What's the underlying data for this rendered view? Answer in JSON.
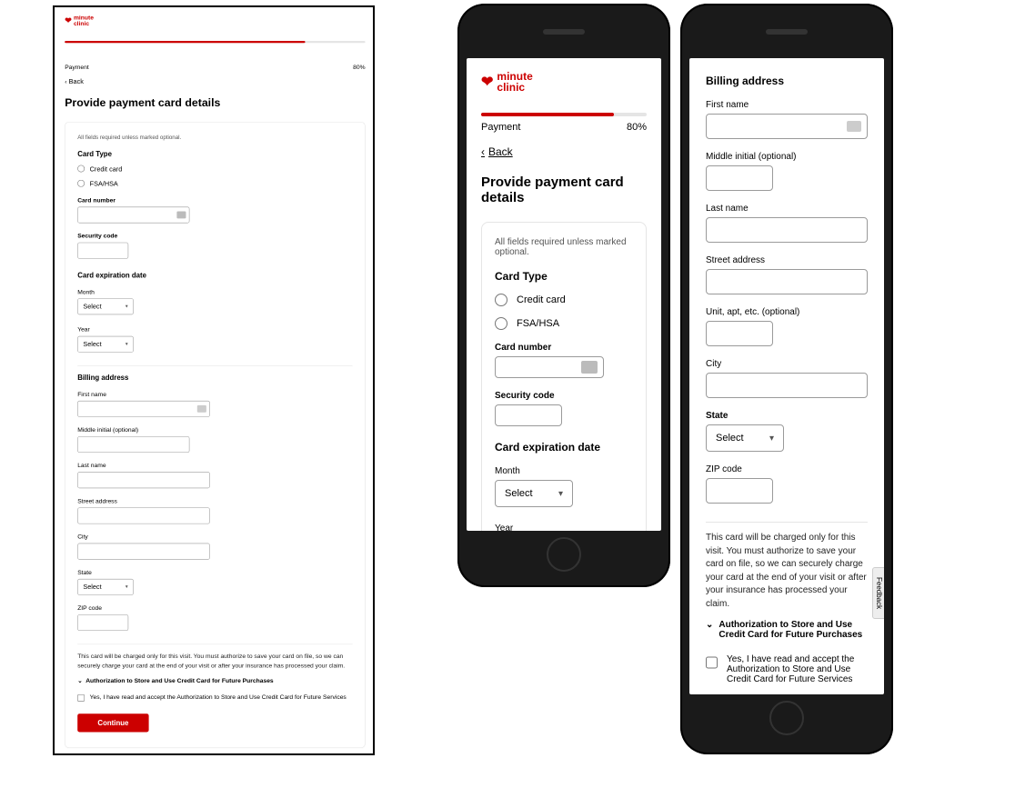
{
  "brand": {
    "name_line1": "minute",
    "name_line2": "clinic"
  },
  "progress": {
    "step_label": "Payment",
    "percent_label": "80%",
    "percent_value": 80
  },
  "back_label": "Back",
  "page_title": "Provide payment card details",
  "form": {
    "required_hint": "All fields required unless marked optional.",
    "card_type": {
      "label": "Card Type",
      "option_credit": "Credit card",
      "option_fsa": "FSA/HSA"
    },
    "card_number_label": "Card number",
    "security_code_label": "Security code",
    "expiration_label": "Card expiration date",
    "month_label": "Month",
    "year_label": "Year",
    "select_placeholder": "Select"
  },
  "billing": {
    "section_label": "Billing address",
    "first_name": "First name",
    "middle_initial": "Middle initial (optional)",
    "last_name": "Last name",
    "street": "Street address",
    "unit": "Unit, apt, etc. (optional)",
    "city": "City",
    "state": "State",
    "zip": "ZIP code"
  },
  "disclosure": {
    "text": "This card will be charged only for this visit. You must authorize to save your card on file, so we can securely charge your card at the end of your visit or after your insurance has processed your claim.",
    "expander_label": "Authorization to Store and Use Credit Card for Future Purchases",
    "checkbox_label": "Yes, I have read and accept the Authorization to Store and Use Credit Card for Future Services"
  },
  "continue_label": "Continue",
  "feedback_label": "Feedback"
}
